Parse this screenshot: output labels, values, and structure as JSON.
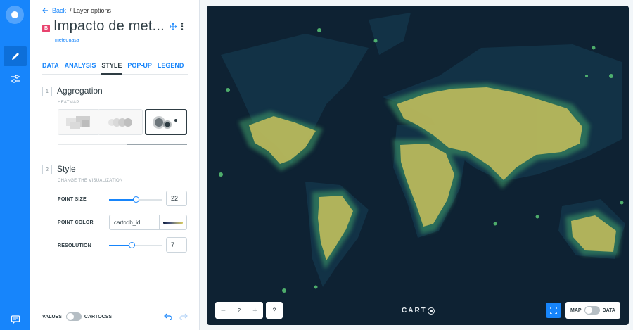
{
  "nav": {
    "back_label": "Back",
    "crumb": "/ Layer options"
  },
  "layer": {
    "badge": "B",
    "title": "Impacto de met...",
    "source": "meteonasa"
  },
  "tabs": [
    {
      "label": "DATA",
      "active": false
    },
    {
      "label": "ANALYSIS",
      "active": false
    },
    {
      "label": "STYLE",
      "active": true
    },
    {
      "label": "POP-UP",
      "active": false
    },
    {
      "label": "LEGEND",
      "active": false
    }
  ],
  "aggregation": {
    "step": "1",
    "title": "Aggregation",
    "subtitle": "HEATMAP"
  },
  "style": {
    "step": "2",
    "title": "Style",
    "subtitle": "CHANGE THE VISUALIZATION",
    "point_size": {
      "label": "POINT SIZE",
      "value": "22",
      "level": 0.5
    },
    "point_color": {
      "label": "POINT COLOR",
      "value": "cartodb_id"
    },
    "resolution": {
      "label": "RESOLUTION",
      "value": "7",
      "level": 0.42
    }
  },
  "footer": {
    "values_label": "VALUES",
    "cartocss_label": "CARTOCSS"
  },
  "map": {
    "zoom_level": "2",
    "help_label": "?",
    "carto_label": "CART",
    "map_label": "MAP",
    "data_label": "DATA"
  },
  "colors": {
    "accent": "#1785fb",
    "map_bg": "#0e2233",
    "land": "#123246",
    "heat": "#c8bf5c",
    "heat_glow": "#3fa06a"
  },
  "icons": {
    "edit": "pencil-icon",
    "layers": "sliders-icon",
    "chat": "chat-icon"
  }
}
